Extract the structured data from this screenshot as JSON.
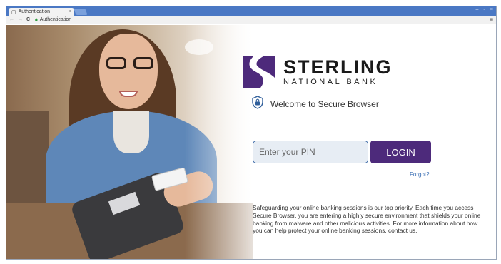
{
  "browser": {
    "tab_title": "Authentication",
    "tab_close": "×",
    "address": "Authentication",
    "nav_back": "←",
    "nav_forward": "→",
    "nav_reload": "C",
    "menu": "≡",
    "window_controls": [
      "–",
      "▫",
      "×"
    ]
  },
  "brand": {
    "name_line1": "STERLING",
    "name_line2": "NATIONAL BANK",
    "accent_color": "#4d2a7b"
  },
  "welcome": {
    "text": "Welcome to Secure Browser"
  },
  "login": {
    "pin_placeholder": "Enter your PIN",
    "pin_value": "",
    "button_label": "LOGIN",
    "forgot_label": "Forgot?"
  },
  "info": {
    "text": "Safeguarding your online banking sessions is our top priority. Each time you access Secure Browser, you are entering a highly secure environment that shields your online banking from malware and other malicious activities. For more information about how you can help protect your online banking sessions, contact us."
  },
  "icons": {
    "page": "page-icon",
    "lock": "lock-icon",
    "shield": "shield-lock-icon",
    "logo": "sterling-logo-icon"
  }
}
